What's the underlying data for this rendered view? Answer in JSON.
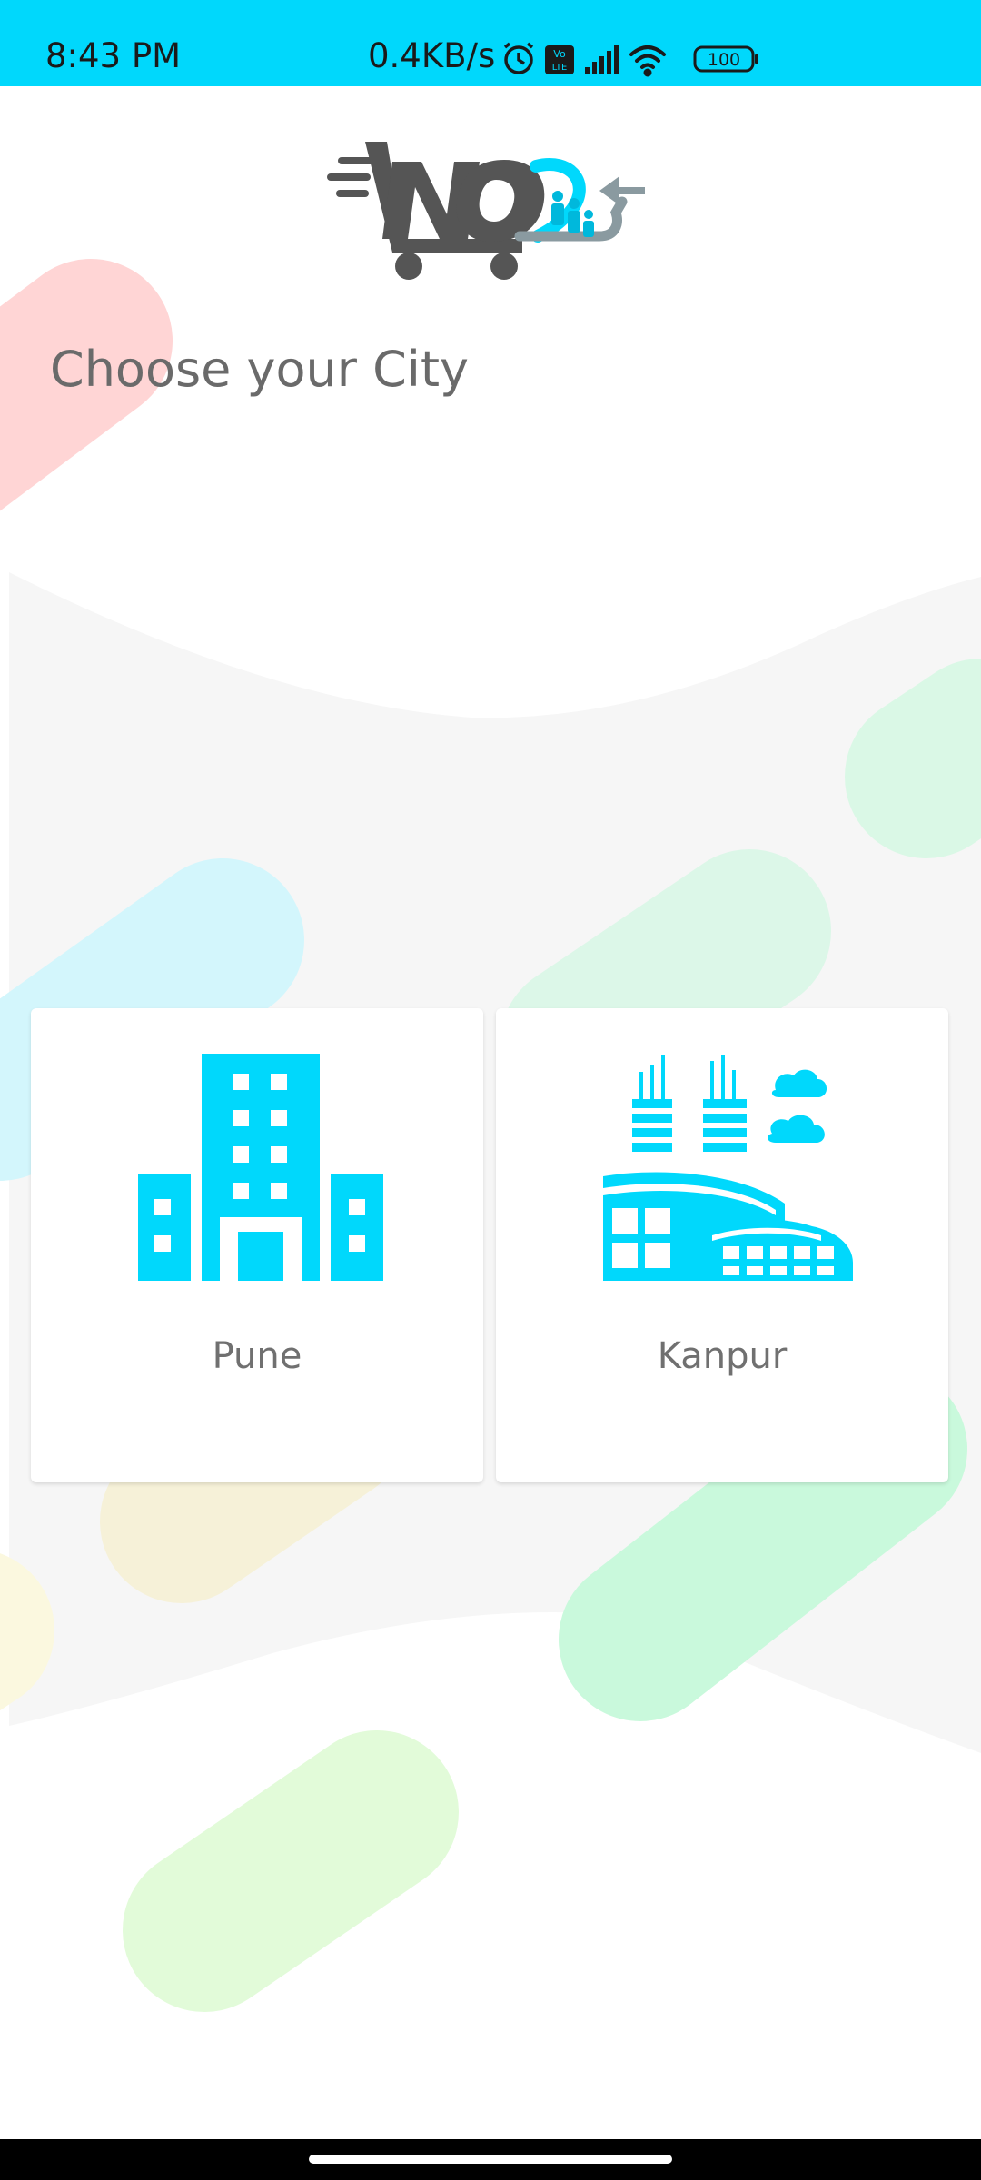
{
  "status_bar": {
    "time": "8:43 PM",
    "network_speed": "0.4KB/s",
    "battery": "100",
    "volte_top": "Vo",
    "volte_bottom": "LTE"
  },
  "heading": "Choose your City",
  "cities": [
    {
      "name": "Pune",
      "icon": "office-buildings-icon"
    },
    {
      "name": "Kanpur",
      "icon": "industrial-city-icon"
    }
  ],
  "colors": {
    "accent": "#00d8fc",
    "logo_dark": "#555555",
    "logo_grey": "#8a9aa0",
    "text": "#6a6a6a"
  }
}
